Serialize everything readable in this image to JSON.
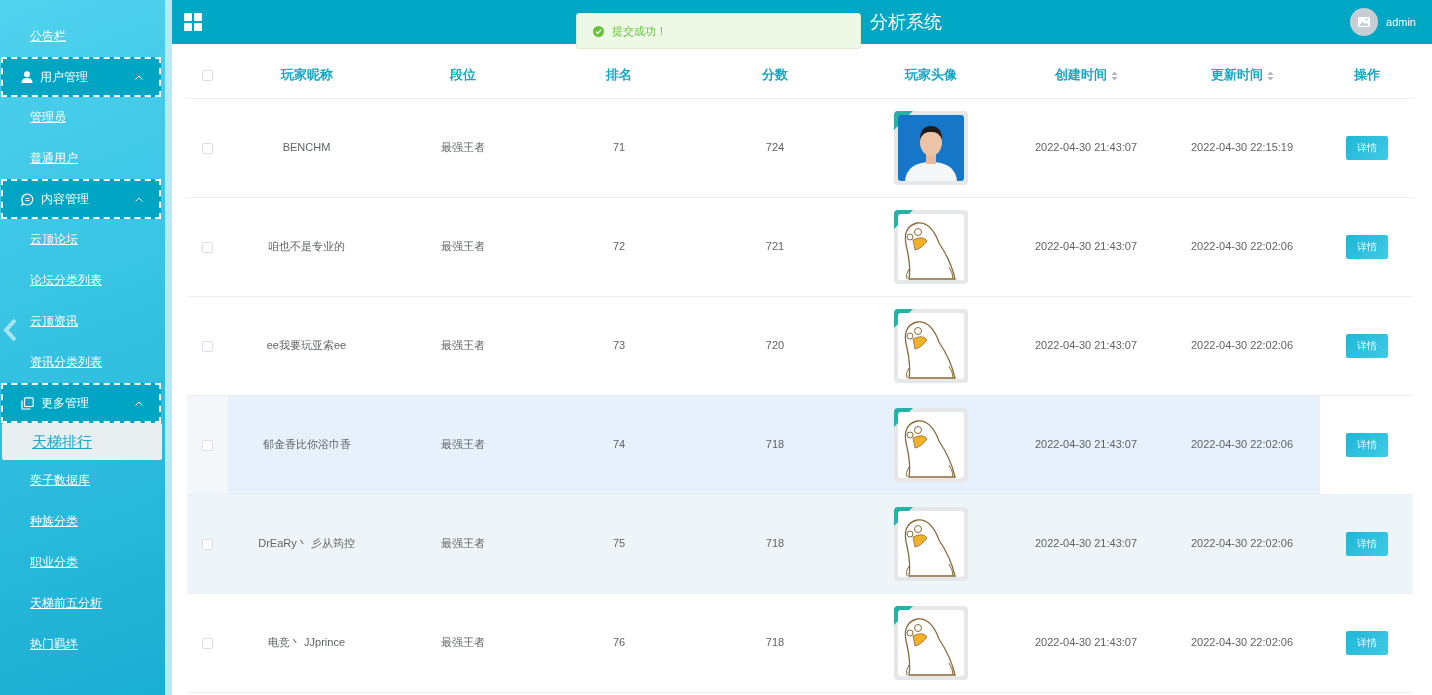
{
  "sidebar": {
    "items": [
      {
        "kind": "link",
        "label": "公告栏",
        "selected": false
      },
      {
        "kind": "group",
        "label": "用户管理",
        "expanded": true,
        "children": [
          {
            "label": "管理员",
            "selected": false
          },
          {
            "label": "普通用户",
            "selected": false
          }
        ]
      },
      {
        "kind": "group",
        "label": "内容管理",
        "expanded": true,
        "children": [
          {
            "label": "云顶论坛",
            "selected": false
          },
          {
            "label": "论坛分类列表",
            "selected": false
          },
          {
            "label": "云顶资讯",
            "selected": false
          },
          {
            "label": "资讯分类列表",
            "selected": false
          }
        ]
      },
      {
        "kind": "group",
        "label": "更多管理",
        "expanded": true,
        "children": [
          {
            "label": "天梯排行",
            "selected": true
          },
          {
            "label": "奕子数据库",
            "selected": false
          },
          {
            "label": "种族分类",
            "selected": false
          },
          {
            "label": "职业分类",
            "selected": false
          },
          {
            "label": "天梯前五分析",
            "selected": false
          },
          {
            "label": "热门羁绊",
            "selected": false
          }
        ]
      }
    ]
  },
  "header": {
    "title": "分析系统",
    "user": "admin"
  },
  "toast": {
    "message": "提交成功！"
  },
  "table": {
    "select_all_checked": false,
    "columns": [
      {
        "label": "玩家昵称",
        "sortable": false
      },
      {
        "label": "段位",
        "sortable": false
      },
      {
        "label": "排名",
        "sortable": false
      },
      {
        "label": "分数",
        "sortable": false
      },
      {
        "label": "玩家头像",
        "sortable": false
      },
      {
        "label": "创建时间",
        "sortable": true
      },
      {
        "label": "更新时间",
        "sortable": true
      },
      {
        "label": "操作",
        "sortable": false
      }
    ],
    "rows": [
      {
        "checked": false,
        "hovered": false,
        "striped": false,
        "nickname": "BENCHM",
        "rank_tier": "最强王者",
        "rank": "71",
        "score": "724",
        "created": "2022-04-30 21:43:07",
        "updated": "2022-04-30 22:15:19",
        "action": "详情"
      },
      {
        "checked": false,
        "hovered": false,
        "striped": false,
        "nickname": "咱也不是专业的",
        "rank_tier": "最强王者",
        "rank": "72",
        "score": "721",
        "created": "2022-04-30 21:43:07",
        "updated": "2022-04-30 22:02:06",
        "action": "详情"
      },
      {
        "checked": false,
        "hovered": false,
        "striped": false,
        "nickname": "ee我要玩亚索ee",
        "rank_tier": "最强王者",
        "rank": "73",
        "score": "720",
        "created": "2022-04-30 21:43:07",
        "updated": "2022-04-30 22:02:06",
        "action": "详情"
      },
      {
        "checked": false,
        "hovered": true,
        "striped": false,
        "nickname": "郁金香比你浴巾香",
        "rank_tier": "最强王者",
        "rank": "74",
        "score": "718",
        "created": "2022-04-30 21:43:07",
        "updated": "2022-04-30 22:02:06",
        "action": "详情"
      },
      {
        "checked": false,
        "hovered": false,
        "striped": true,
        "nickname": "DrEaRy丶 彡从筠控",
        "rank_tier": "最强王者",
        "rank": "75",
        "score": "718",
        "created": "2022-04-30 21:43:07",
        "updated": "2022-04-30 22:02:06",
        "action": "详情"
      },
      {
        "checked": false,
        "hovered": false,
        "striped": false,
        "nickname": "电竞丶 JJprince",
        "rank_tier": "最强王者",
        "rank": "76",
        "score": "718",
        "created": "2022-04-30 21:43:07",
        "updated": "2022-04-30 22:02:06",
        "action": "详情"
      }
    ]
  }
}
